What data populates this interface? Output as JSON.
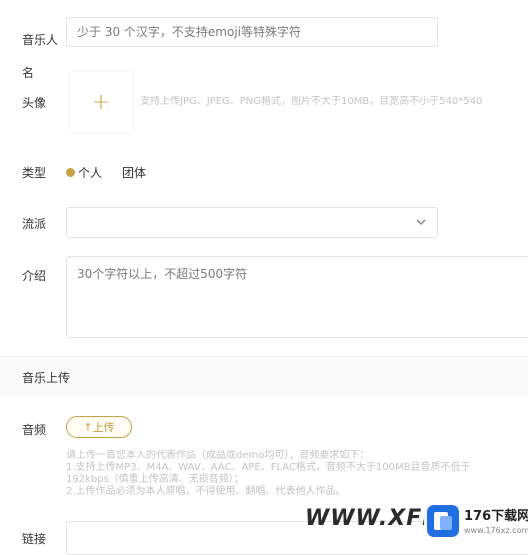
{
  "form": {
    "name_label": "音乐人名",
    "name_placeholder": "少于 30 个汉字，不支持emoji等特殊字符",
    "avatar_label": "头像",
    "avatar_plus": "+",
    "avatar_hint": "支持上传JPG、JPEG、PNG格式，图片不大于10MB，且宽高不小于540*540",
    "type_label": "类型",
    "type_options": [
      "个人",
      "团体"
    ],
    "genre_label": "流派",
    "intro_label": "介绍",
    "intro_placeholder": "30个字符以上，不超过500字符"
  },
  "upload_section": {
    "title": "音乐上传",
    "audio_label": "音频",
    "upload_button": "↑上传",
    "hint_lines": [
      "请上传一首您本人的代表作品（成品或demo均可），音频要求如下：",
      "1.支持上传MP3、M4A、WAV、AAC、APE、FLAC格式，音频不大于100MB且音质不低于",
      "192kbps（慎重上传高清、无损音频）；",
      "2.上传作品必须为本人原唱，不得使用、翻唱、代表他人作品。"
    ],
    "link_label": "链接"
  },
  "watermark": {
    "text": "WWW.XFDO",
    "badge_text": "176下载网",
    "badge_sub": "www.176xz.com"
  },
  "colors": {
    "accent": "#c8a045",
    "border": "#e3e3e3",
    "hint": "#c4c4c4",
    "section_bg": "#fafafa"
  }
}
